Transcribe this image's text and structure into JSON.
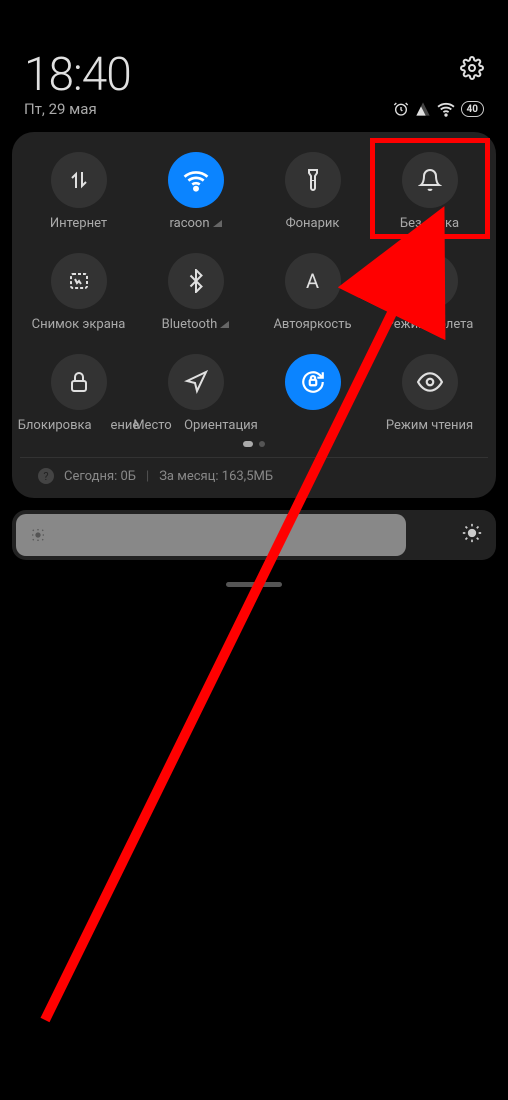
{
  "header": {
    "time": "18:40",
    "date": "Пт, 29 мая",
    "battery": "40"
  },
  "tiles": {
    "row1": [
      {
        "label": "Интернет",
        "icon": "data-swap",
        "active": false
      },
      {
        "label": "racoon",
        "icon": "wifi",
        "active": true,
        "signal": true
      },
      {
        "label": "Фонарик",
        "icon": "torch",
        "active": false
      },
      {
        "label": "Без звука",
        "icon": "bell",
        "active": false,
        "highlight": true
      }
    ],
    "row2": [
      {
        "label": "Снимок экрана",
        "icon": "screenshot",
        "active": false
      },
      {
        "label": "Bluetooth",
        "icon": "bluetooth",
        "active": false,
        "signal": true
      },
      {
        "label": "Автояркость",
        "icon": "auto-bright",
        "active": false
      },
      {
        "label": "Режим полета",
        "icon": "airplane",
        "active": false
      }
    ],
    "row3": [
      {
        "label": "Блокировка",
        "icon": "lock",
        "active": false
      },
      {
        "label": "ение",
        "icon": "nav-arrow",
        "active": false
      },
      {
        "label": "Место",
        "icon": "",
        "active": false,
        "hidden": true
      },
      {
        "label": "Ориентация",
        "icon": "rotate-lock",
        "active": true
      },
      {
        "label": "Режим чтения",
        "icon": "eye",
        "active": false
      }
    ]
  },
  "data_usage": {
    "today_label": "Сегодня: 0Б",
    "month_label": "За месяц: 163,5МБ"
  }
}
